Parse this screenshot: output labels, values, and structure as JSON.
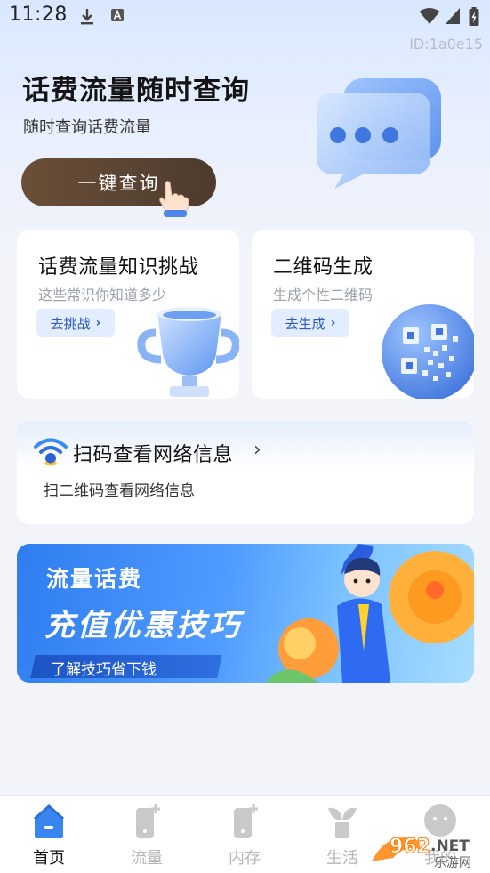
{
  "status_bar": {
    "time": "11:28"
  },
  "page_id": "ID:1a0e15",
  "hero": {
    "title": "话费流量随时查询",
    "subtitle": "随时查询话费流量",
    "button_label": "一键查询"
  },
  "cards": [
    {
      "title": "话费流量知识挑战",
      "subtitle": "这些常识你知道多少",
      "action": "去挑战"
    },
    {
      "title": "二维码生成",
      "subtitle": "生成个性二维码",
      "action": "去生成"
    }
  ],
  "network_card": {
    "title": "扫码查看网络信息",
    "subtitle": "扫二维码查看网络信息"
  },
  "banner": {
    "line1": "流量话费",
    "line2": "充值优惠技巧",
    "line3": "了解技巧省下钱"
  },
  "nav": [
    {
      "label": "首页",
      "icon": "home-icon",
      "active": true
    },
    {
      "label": "流量",
      "icon": "phone-plus-icon",
      "active": false
    },
    {
      "label": "内存",
      "icon": "phone-plus-icon",
      "active": false
    },
    {
      "label": "生活",
      "icon": "sprout-icon",
      "active": false
    },
    {
      "label": "我的",
      "icon": "profile-icon",
      "active": false
    }
  ],
  "watermark": {
    "text": "962.NET",
    "subtext": "乐游网"
  },
  "colors": {
    "accent": "#2d5bb6",
    "button": "#5a4433",
    "banner": "#3e8cf5"
  }
}
